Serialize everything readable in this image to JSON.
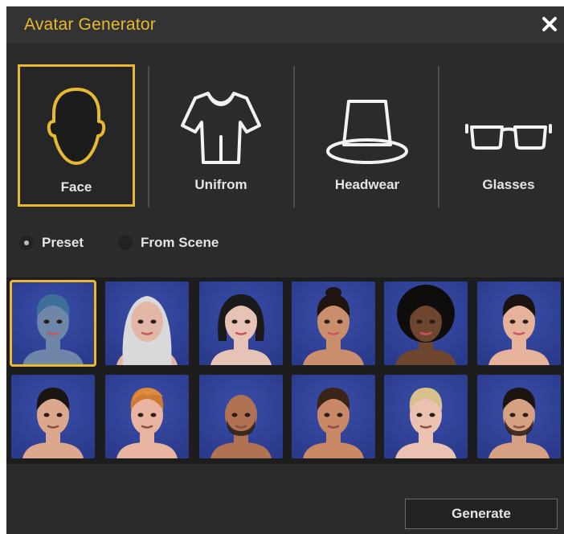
{
  "window": {
    "title": "Avatar Generator"
  },
  "tabs": [
    {
      "label": "Face",
      "icon": "face-outline-icon",
      "selected": true
    },
    {
      "label": "Unifrom",
      "icon": "shirt-icon",
      "selected": false
    },
    {
      "label": "Headwear",
      "icon": "hat-icon",
      "selected": false
    },
    {
      "label": "Glasses",
      "icon": "glasses-icon",
      "selected": false
    }
  ],
  "source": {
    "options": [
      {
        "label": "Preset",
        "selected": true
      },
      {
        "label": "From Scene",
        "selected": false
      }
    ]
  },
  "avatars": [
    {
      "icon": "avatar-female-blue-hair",
      "skin": "#6f86a8",
      "hair": "#3d6f9a",
      "selected": true
    },
    {
      "icon": "avatar-female-hijab",
      "skin": "#e2b7a6",
      "hair": "#d9d9d9",
      "selected": false
    },
    {
      "icon": "avatar-female-dark-bob",
      "skin": "#e7c3b5",
      "hair": "#1a1a1a",
      "selected": false
    },
    {
      "icon": "avatar-female-bun",
      "skin": "#c98e6c",
      "hair": "#1f1410",
      "selected": false
    },
    {
      "icon": "avatar-female-curly",
      "skin": "#6e4630",
      "hair": "#0f0d0c",
      "selected": false
    },
    {
      "icon": "avatar-female-bangs",
      "skin": "#e6b29a",
      "hair": "#1a1310",
      "selected": false
    },
    {
      "icon": "avatar-male-short-dark",
      "skin": "#dba88e",
      "hair": "#1a1412",
      "selected": false
    },
    {
      "icon": "avatar-male-ginger",
      "skin": "#e8b39f",
      "hair": "#cf7a34",
      "selected": false
    },
    {
      "icon": "avatar-male-bald-beard",
      "skin": "#b07252",
      "hair": "#2a1a14",
      "selected": false
    },
    {
      "icon": "avatar-male-fade",
      "skin": "#c98866",
      "hair": "#3a2418",
      "selected": false
    },
    {
      "icon": "avatar-male-blond",
      "skin": "#ebc2b1",
      "hair": "#d8c08a",
      "selected": false
    },
    {
      "icon": "avatar-male-beard",
      "skin": "#d6a083",
      "hair": "#1c1411",
      "selected": false
    }
  ],
  "actions": {
    "generate_label": "Generate"
  },
  "colors": {
    "accent": "#e8b930",
    "background": "#2b2b2b",
    "avatar_bg": "#2a3a8c"
  }
}
